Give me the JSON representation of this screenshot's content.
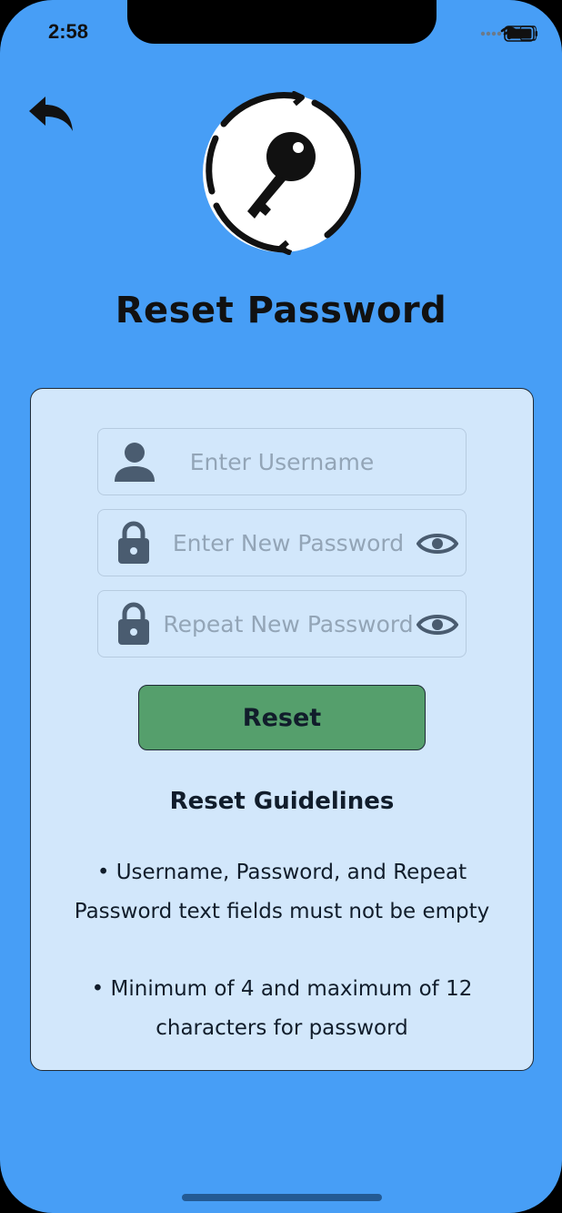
{
  "status_bar": {
    "time": "2:58"
  },
  "header": {
    "back_icon": "back-arrow-icon",
    "logo_icon": "key-reset-icon",
    "title": "Reset Password"
  },
  "form": {
    "username": {
      "icon": "user-icon",
      "placeholder": "Enter Username",
      "value": ""
    },
    "new_password": {
      "icon": "lock-icon",
      "placeholder": "Enter New Password",
      "value": "",
      "toggle_icon": "eye-icon"
    },
    "repeat_password": {
      "icon": "lock-icon",
      "placeholder": "Repeat New Password",
      "value": "",
      "toggle_icon": "eye-icon"
    },
    "reset_label": "Reset"
  },
  "guidelines": {
    "title": "Reset Guidelines",
    "items": [
      "• Username, Password, and Repeat Password text fields must not be empty",
      "• Minimum of 4 and maximum of 12 characters for password"
    ]
  },
  "colors": {
    "background": "#479ef6",
    "card": "#d2e7fb",
    "button": "#559f6c",
    "icon": "#4a5c70"
  }
}
